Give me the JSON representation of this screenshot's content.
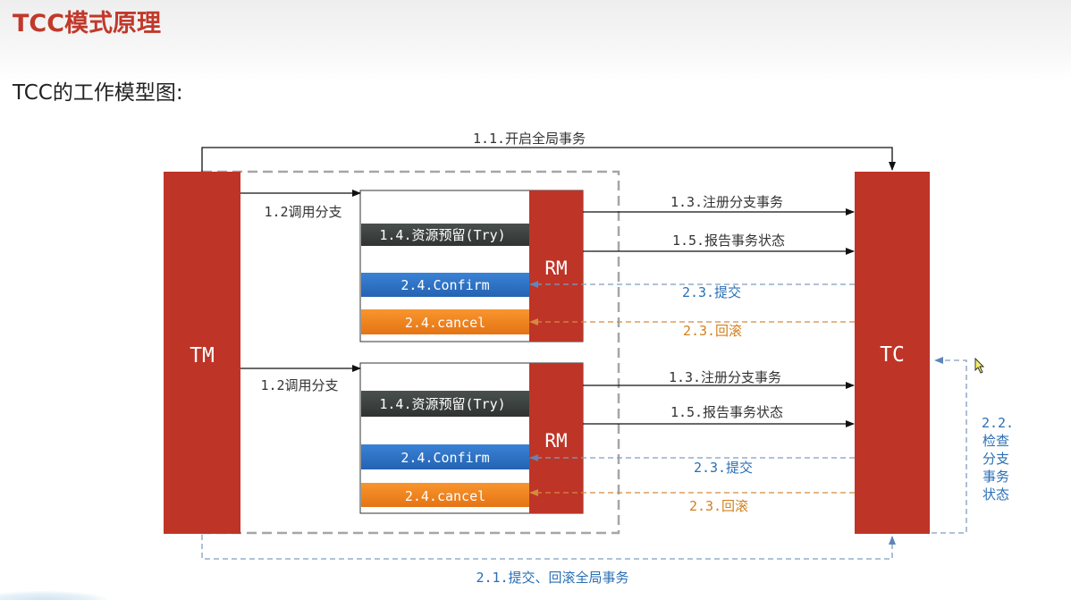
{
  "page": {
    "title": "TCC模式原理",
    "subtitle": "TCC的工作模型图:"
  },
  "diagram": {
    "tm_label": "TM",
    "tc_label": "TC",
    "rm_label": "RM",
    "begin_global": "1.1.开启全局事务",
    "end_global": "2.1.提交、回滚全局事务",
    "check_status": [
      "2.2.",
      "检查",
      "分支",
      "事务",
      "状态"
    ],
    "groups": [
      {
        "call_branch": "1.2调用分支",
        "register": "1.3.注册分支事务",
        "report": "1.5.报告事务状态",
        "commit": "2.3.提交",
        "rollback": "2.3.回滚",
        "try_label": "1.4.资源预留(Try)",
        "confirm_label": "2.4.Confirm",
        "cancel_label": "2.4.cancel"
      },
      {
        "call_branch": "1.2调用分支",
        "register": "1.3.注册分支事务",
        "report": "1.5.报告事务状态",
        "commit": "2.3.提交",
        "rollback": "2.3.回滚",
        "try_label": "1.4.资源预留(Try)",
        "confirm_label": "2.4.Confirm",
        "cancel_label": "2.4.cancel"
      }
    ],
    "colors": {
      "red": "#be3427",
      "dark": "#3f4442",
      "blue": "#2f73c6",
      "orange": "#f08422",
      "arrow": "#111111",
      "dash_blue": "#7f9ec0",
      "dash_orange": "#d58a3e",
      "label_blue": "#2a6fb5",
      "label_orange": "#d1801d"
    }
  }
}
